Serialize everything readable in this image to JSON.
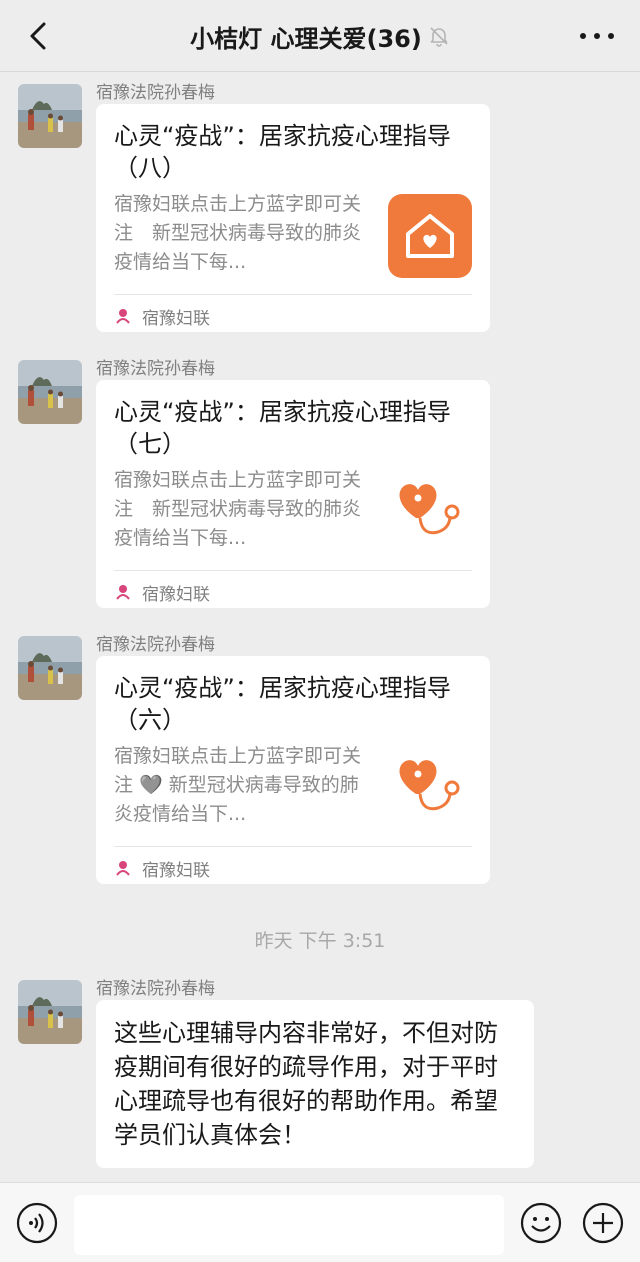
{
  "header": {
    "title": "小桔灯 心理关爱(36)"
  },
  "messages": [
    {
      "sender": "宿豫法院孙春梅",
      "card": {
        "title": "心灵“疫战”：居家抗疫心理指导（八）",
        "desc": "宿豫妇联点击上方蓝字即可关注　新型冠状病毒导致的肺炎疫情给当下每...",
        "source": "宿豫妇联",
        "thumb": "house-heart-icon"
      }
    },
    {
      "sender": "宿豫法院孙春梅",
      "card": {
        "title": "心灵“疫战”：居家抗疫心理指导（七）",
        "desc": "宿豫妇联点击上方蓝字即可关注　新型冠状病毒导致的肺炎疫情给当下每...",
        "source": "宿豫妇联",
        "thumb": "heart-stethoscope-icon"
      }
    },
    {
      "sender": "宿豫法院孙春梅",
      "card": {
        "title": "心灵“疫战”：居家抗疫心理指导（六）",
        "desc": "宿豫妇联点击上方蓝字即可关注 🩶 新型冠状病毒导致的肺炎疫情给当下...",
        "source": "宿豫妇联",
        "thumb": "heart-stethoscope-icon"
      }
    }
  ],
  "timestamp": "昨天 下午 3:51",
  "text_message": {
    "sender": "宿豫法院孙春梅",
    "text": "这些心理辅导内容非常好，不但对防疫期间有很好的疏导作用，对于平时心理疏导也有很好的帮助作用。希望学员们认真体会！"
  },
  "input_bar": {
    "placeholder": ""
  },
  "colors": {
    "accent_orange": "#f07a3c",
    "background": "#ededed",
    "bubble": "#ffffff"
  }
}
